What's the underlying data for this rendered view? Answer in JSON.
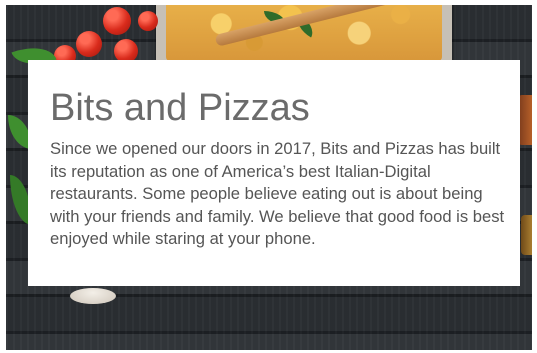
{
  "background": {
    "description_icon": "pizza-photo-background",
    "board_color": "#2b2f33"
  },
  "card": {
    "title": "Bits and Pizzas",
    "body": "Since we opened our doors in 2017, Bits and Pizzas has built its reputation as one of America’s best Italian-Digital restaurants. Some people believe eating out is about being with your friends and family. We believe that good food is best enjoyed while staring at your phone.",
    "background_color": "#ffffff",
    "text_color": "#555555",
    "title_color": "#6b6b6b"
  }
}
